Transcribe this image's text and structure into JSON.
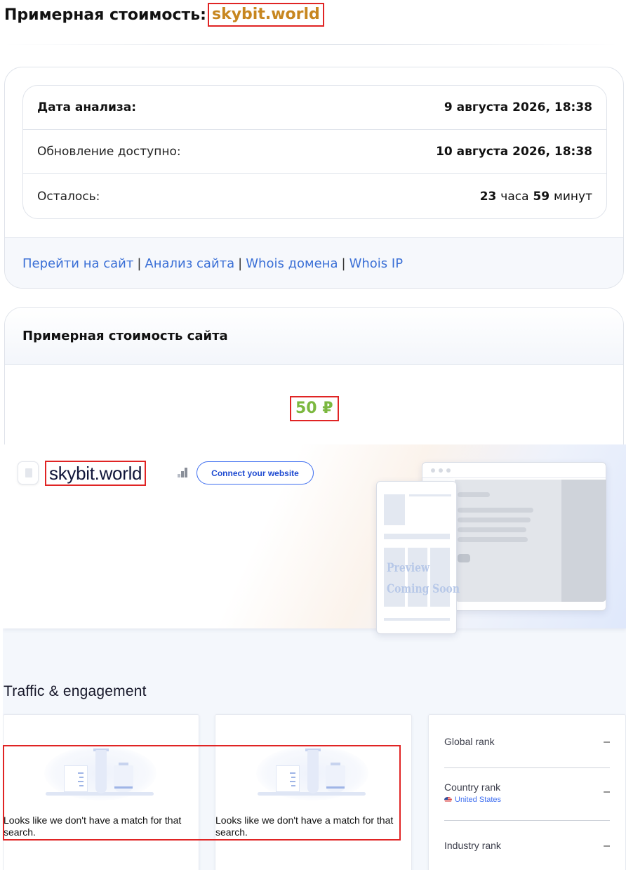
{
  "page_title": {
    "prefix": "Примерная стоимость:",
    "domain": "skybit.world"
  },
  "analysis": {
    "rows": [
      {
        "label": "Дата анализа:",
        "value": "9 августа 2026, 18:38"
      },
      {
        "label": "Обновление доступно:",
        "value": "10 августа 2026, 18:38"
      }
    ],
    "remaining": {
      "label": "Осталось:",
      "hours": "23",
      "hours_unit": "часа",
      "minutes": "59",
      "minutes_unit": "минут"
    }
  },
  "links": {
    "separator": "|",
    "items": [
      "Перейти на сайт",
      "Анализ сайта",
      "Whois домена",
      "Whois IP"
    ]
  },
  "valuation": {
    "heading": "Примерная стоимость сайта",
    "price": "50 ₽"
  },
  "similarweb": {
    "domain": "skybit.world",
    "connect_button": "Connect your website",
    "preview_line1": "Preview",
    "preview_line2": "Coming Soon",
    "section_title": "Traffic & engagement",
    "no_match_text": "Looks like we don't have a match for that search.",
    "ranks": [
      {
        "label": "Global rank",
        "value": "–"
      },
      {
        "label": "Country rank",
        "value": "–",
        "country": "United States"
      },
      {
        "label": "Industry rank",
        "value": "–"
      }
    ],
    "icons": [
      "file-icon",
      "rank-bars-icon",
      "us-flag-icon",
      "empty-state-illustration"
    ]
  }
}
